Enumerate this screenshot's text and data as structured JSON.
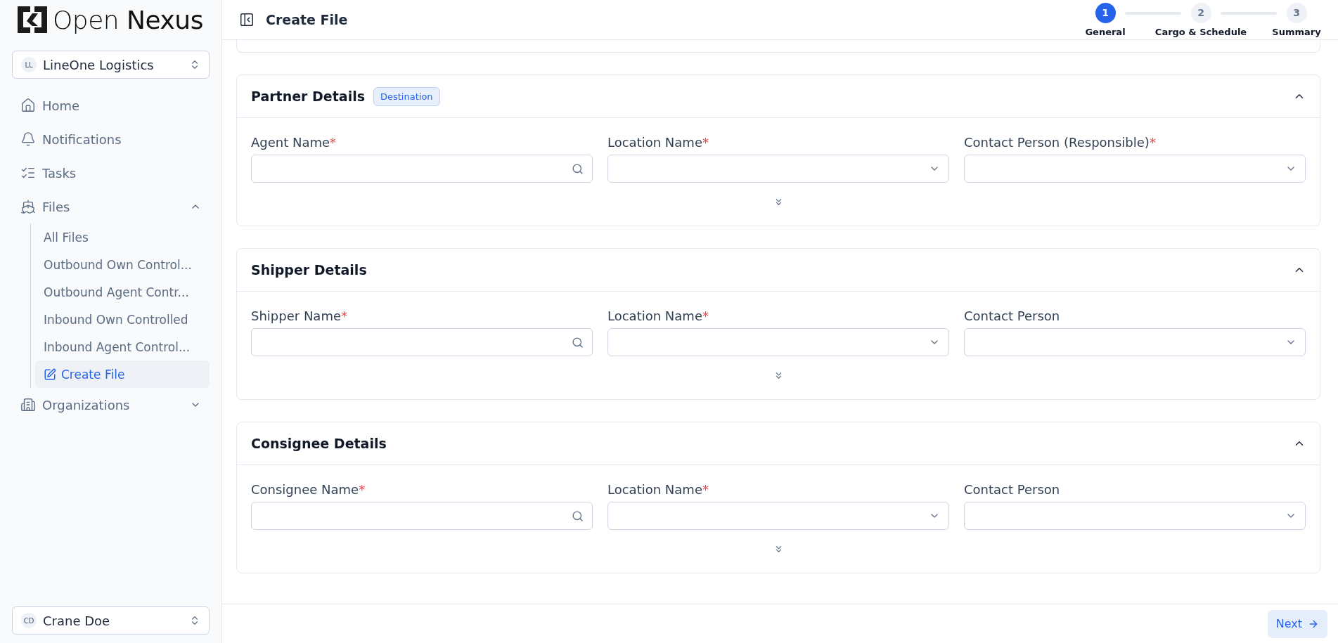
{
  "logo": {
    "text": "Open **Nexus**"
  },
  "org_switcher": {
    "initials": "LL",
    "name": "LineOne Logistics"
  },
  "sidebar": {
    "items": [
      {
        "label": "Home",
        "selected": false
      },
      {
        "label": "Notifications",
        "selected": false
      },
      {
        "label": "Tasks",
        "selected": false
      },
      {
        "label": "Files",
        "selected": false,
        "expanded": true,
        "children": [
          {
            "label": "All Files",
            "selected": false
          },
          {
            "label": "Outbound Own Control...",
            "selected": false
          },
          {
            "label": "Outbound Agent Contr...",
            "selected": false
          },
          {
            "label": "Inbound Own Controlled",
            "selected": false
          },
          {
            "label": "Inbound Agent Control...",
            "selected": false
          },
          {
            "label": "Create File",
            "selected": true
          }
        ]
      },
      {
        "label": "Organizations",
        "selected": false,
        "expanded": false
      }
    ]
  },
  "user_switcher": {
    "initials": "CD",
    "name": "Crane Doe"
  },
  "header": {
    "title": "Create File"
  },
  "stepper": [
    {
      "number": "1",
      "label": "General",
      "selected": true
    },
    {
      "number": "2",
      "label": "Cargo & Schedule",
      "selected": false
    },
    {
      "number": "3",
      "label": "Summary",
      "selected": false
    }
  ],
  "sections": [
    {
      "title": "Partner Details",
      "badge": "Destination",
      "expanded": true,
      "fields": [
        {
          "label": "Agent Name",
          "required_mark": "*",
          "kind": "search"
        },
        {
          "label": "Location Name",
          "required_mark": "*",
          "kind": "select"
        },
        {
          "label": "Contact Person (Responsible)",
          "required_mark": "*",
          "kind": "select"
        }
      ]
    },
    {
      "title": "Shipper Details",
      "expanded": true,
      "fields": [
        {
          "label": "Shipper Name",
          "required_mark": "*",
          "kind": "search"
        },
        {
          "label": "Location Name",
          "required_mark": "*",
          "kind": "select"
        },
        {
          "label": "Contact Person",
          "kind": "select"
        }
      ]
    },
    {
      "title": "Consignee Details",
      "expanded": true,
      "fields": [
        {
          "label": "Consignee Name",
          "required_mark": "*",
          "kind": "search"
        },
        {
          "label": "Location Name",
          "required_mark": "*",
          "kind": "select"
        },
        {
          "label": "Contact Person",
          "kind": "select"
        }
      ]
    }
  ],
  "footer": {
    "next_button": "Next"
  }
}
